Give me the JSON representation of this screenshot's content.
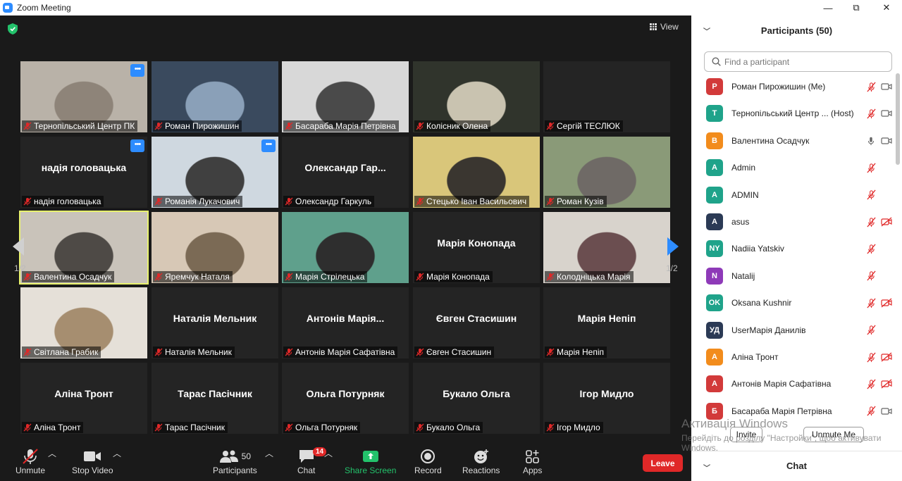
{
  "window": {
    "title": "Zoom Meeting",
    "controls": [
      "—",
      "⧉",
      "✕"
    ]
  },
  "stage": {
    "view_label": "View",
    "page_left": "1/2",
    "page_right": "1/2"
  },
  "tiles": [
    {
      "label": "Тернопільський Центр ПК",
      "big": "",
      "video": true,
      "more": true
    },
    {
      "label": "Роман Пирожишин",
      "big": "",
      "video": true,
      "more": false
    },
    {
      "label": "Басараба Марія Петрівна",
      "big": "",
      "video": true,
      "more": false
    },
    {
      "label": "Колісник Олена",
      "big": "",
      "video": true,
      "more": false
    },
    {
      "label": "Сергій ТЕСЛЮК",
      "big": "",
      "video": false,
      "more": false
    },
    {
      "label": "надія головацька",
      "big": "надія головацька",
      "video": false,
      "more": true
    },
    {
      "label": "Романія Лукачович",
      "big": "",
      "video": true,
      "more": true
    },
    {
      "label": "Олександр Гаркуль",
      "big": "Олександр  Гар...",
      "video": false,
      "more": false
    },
    {
      "label": "Стецько Іван Васильович",
      "big": "",
      "video": true,
      "more": false
    },
    {
      "label": "Роман Кузів",
      "big": "",
      "video": true,
      "more": false
    },
    {
      "label": "Валентина Осадчук",
      "big": "",
      "video": true,
      "more": false,
      "active": true
    },
    {
      "label": "Яремчук Наталя",
      "big": "",
      "video": true,
      "more": false
    },
    {
      "label": "Марія Стрілецька",
      "big": "",
      "video": true,
      "more": false
    },
    {
      "label": "Марія Конопада",
      "big": "Марія Конопада",
      "video": false,
      "more": false
    },
    {
      "label": "Колодніцька Марія",
      "big": "",
      "video": true,
      "more": false
    },
    {
      "label": "Світлана Грабик",
      "big": "",
      "video": true,
      "more": false
    },
    {
      "label": "Наталія Мельник",
      "big": "Наталія Мельник",
      "video": false,
      "more": false
    },
    {
      "label": "Антонів Марія Сафатівна",
      "big": "Антонів  Марія...",
      "video": false,
      "more": false
    },
    {
      "label": "Євген Стасишин",
      "big": "Євген Стасишин",
      "video": false,
      "more": false
    },
    {
      "label": "Марія Непіп",
      "big": "Марія Непіп",
      "video": false,
      "more": false
    },
    {
      "label": "Аліна Тронт",
      "big": "Аліна Тронт",
      "video": false,
      "more": false
    },
    {
      "label": "Тарас Пасічник",
      "big": "Тарас Пасічник",
      "video": false,
      "more": false
    },
    {
      "label": "Ольга Потурняк",
      "big": "Ольга Потурняк",
      "video": false,
      "more": false
    },
    {
      "label": "Букало Ольга",
      "big": "Букало Ольга",
      "video": false,
      "more": false
    },
    {
      "label": "Ігор Мидло",
      "big": "Ігор Мидло",
      "video": false,
      "more": false
    }
  ],
  "toolbar": {
    "unmute": "Unmute",
    "stop_video": "Stop Video",
    "participants": "Participants",
    "participants_count": "50",
    "chat": "Chat",
    "chat_badge": "14",
    "share_screen": "Share Screen",
    "record": "Record",
    "reactions": "Reactions",
    "apps": "Apps",
    "leave": "Leave"
  },
  "sidebar": {
    "title": "Participants (50)",
    "search_placeholder": "Find a participant",
    "invite": "Invite",
    "unmute_me": "Unmute Me",
    "chat_title": "Chat",
    "participants": [
      {
        "initials": "Р",
        "name": "Роман Пирожишин (Me)",
        "color": "#d23a3a",
        "mic": "muted",
        "video": "on"
      },
      {
        "initials": "Т",
        "name": "Тернопільський Центр ...  (Host)",
        "color": "#1fa38a",
        "mic": "muted",
        "video": "on"
      },
      {
        "initials": "В",
        "name": "Валентина Осадчук",
        "color": "#f28c1c",
        "mic": "on",
        "video": "on"
      },
      {
        "initials": "A",
        "name": "Admin",
        "color": "#1fa38a",
        "mic": "muted",
        "video": "none"
      },
      {
        "initials": "A",
        "name": "ADMIN",
        "color": "#1fa38a",
        "mic": "muted",
        "video": "none"
      },
      {
        "initials": "A",
        "name": "asus",
        "color": "#2b3a55",
        "mic": "muted",
        "video": "off"
      },
      {
        "initials": "NY",
        "name": "Nadiia Yatskiv",
        "color": "#1fa38a",
        "mic": "muted",
        "video": "none"
      },
      {
        "initials": "N",
        "name": "Natalij",
        "color": "#8e3ab8",
        "mic": "muted",
        "video": "none"
      },
      {
        "initials": "OK",
        "name": "Oksana Kushnir",
        "color": "#1fa38a",
        "mic": "muted",
        "video": "off"
      },
      {
        "initials": "УД",
        "name": "UserМарія  Данилів",
        "color": "#2b3a55",
        "mic": "muted",
        "video": "none"
      },
      {
        "initials": "А",
        "name": "Аліна Тронт",
        "color": "#f28c1c",
        "mic": "muted",
        "video": "off"
      },
      {
        "initials": "А",
        "name": "Антонів Марія Сафатівна",
        "color": "#d23a3a",
        "mic": "muted",
        "video": "off"
      },
      {
        "initials": "Б",
        "name": "Басараба Марія Петрівна",
        "color": "#d23a3a",
        "mic": "muted",
        "video": "on"
      }
    ]
  },
  "watermark": {
    "line1": "Активація Windows",
    "line2": "Перейдіть до розділу \"Настройки\", щоб активувати Windows."
  },
  "colors": {
    "accent": "#2d8cff",
    "leave": "#e02828",
    "muted_icon": "#e02828",
    "share_green": "#23c26b",
    "active_speaker": "#e8f26e"
  }
}
